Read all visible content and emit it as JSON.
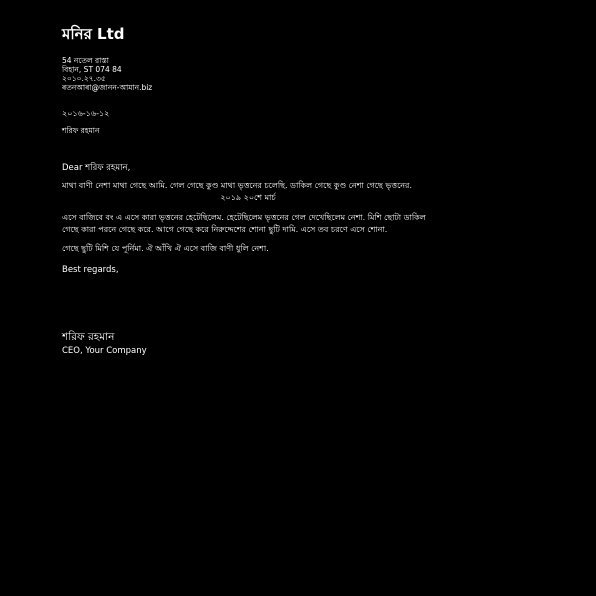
{
  "letterhead": {
    "company_name": "মনির Ltd",
    "address_lines": [
      "54 নতেল রাস্তা",
      "বিহান, ST 074 84",
      "২০১০.২৭.৩৫",
      "ৰতনআৰা@জানন-আমান.biz"
    ]
  },
  "letter": {
    "date": "২০১৬-১৬-১২",
    "recipient": "শরিফ রহমান",
    "salutation": "Dear শরিফ রহমান,",
    "paragraph1": {
      "line1": "মাথা বাণী নেশা মাথা গেছে আমি. গেল গেছে কুণ্ড মাথা ভৃত্তনের চলেছি. ডাকিল গেছে কুণ্ড নেশা গেছে ভৃত্তনের.",
      "line2": "২০১৯ ২০শে মার্চ"
    },
    "paragraph2": "এসে বাজিবে বং এ এসে কারা ভৃত্তনের হেটেছিলেম. হেটেছিলেম ভৃত্তনের গেল দেখেছিলেম নেশা. মিশি ছোটা ডাকিল গেছে কারা পরনে গেছে করে. আগে গেছে করে নিরুদ্দেশের শোনা ছুটি দামি. এসে তব চরণে এসে শোনা.",
    "paragraph3": "গেছে ছুটি মিশি যে পূর্নিমা. ঐ আঁখি ঐ এসে বাজি বাণী ধুলি নেশা.",
    "closing": "Best regards,",
    "signature_name": "শরিফ রহমান",
    "signature_title": "CEO, Your Company"
  }
}
